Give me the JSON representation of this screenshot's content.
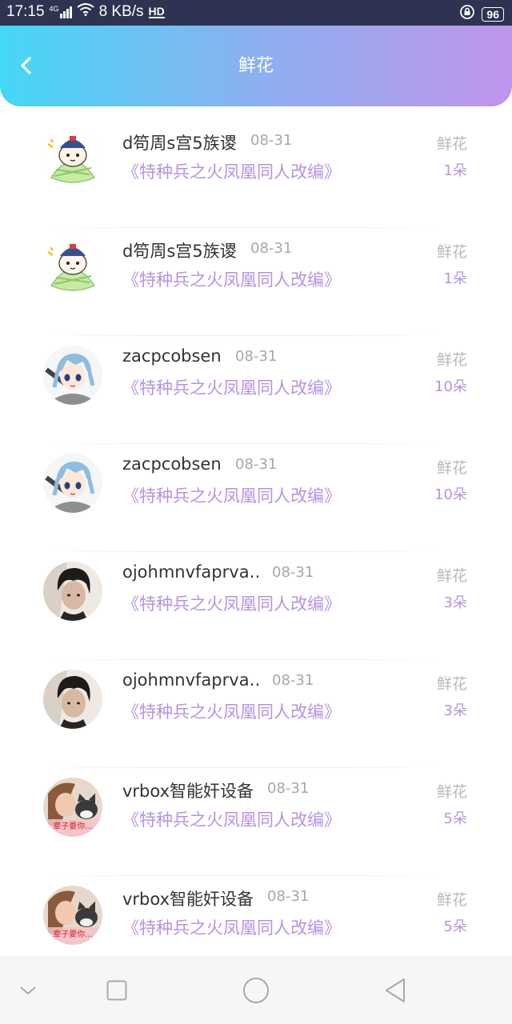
{
  "status_bar": {
    "time": "17:15",
    "network": "4G",
    "speed": "8 KB/s",
    "hd": "HD",
    "battery": "96"
  },
  "header": {
    "title": "鲜花"
  },
  "items": [
    {
      "name": "d笱周s宫5族谡",
      "date": "08-31",
      "book": "《特种兵之火凤凰同人改编》",
      "type": "鲜花",
      "count": "1朵",
      "avatar": "cartoon-rice-dumpling"
    },
    {
      "name": "d笱周s宫5族谡",
      "date": "08-31",
      "book": "《特种兵之火凤凰同人改编》",
      "type": "鲜花",
      "count": "1朵",
      "avatar": "cartoon-rice-dumpling"
    },
    {
      "name": "zacpcobsen",
      "date": "08-31",
      "book": "《特种兵之火凤凰同人改编》",
      "type": "鲜花",
      "count": "10朵",
      "avatar": "anime-blue-hair"
    },
    {
      "name": "zacpcobsen",
      "date": "08-31",
      "book": "《特种兵之火凤凰同人改编》",
      "type": "鲜花",
      "count": "10朵",
      "avatar": "anime-blue-hair"
    },
    {
      "name": "ojohmnvfaprva…",
      "date": "08-31",
      "book": "《特种兵之火凤凰同人改编》",
      "type": "鲜花",
      "count": "3朵",
      "avatar": "dark-hair-photo"
    },
    {
      "name": "ojohmnvfaprva…",
      "date": "08-31",
      "book": "《特种兵之火凤凰同人改编》",
      "type": "鲜花",
      "count": "3朵",
      "avatar": "dark-hair-photo"
    },
    {
      "name": "vrbox智能奸设备",
      "date": "08-31",
      "book": "《特种兵之火凤凰同人改编》",
      "type": "鲜花",
      "count": "5朵",
      "avatar": "woman-cat-photo",
      "avatar_text": "辈子要你..."
    },
    {
      "name": "vrbox智能奸设备",
      "date": "08-31",
      "book": "《特种兵之火凤凰同人改编》",
      "type": "鲜花",
      "count": "5朵",
      "avatar": "woman-cat-photo",
      "avatar_text": "辈子要你..."
    }
  ],
  "colors": {
    "header_gradient_start": "#45d7f7",
    "header_gradient_end": "#c094ec",
    "accent_purple": "#b693e0",
    "status_bar": "#2d3350"
  },
  "icons": {
    "back": "chevron-left-icon",
    "nav_hide": "chevron-down-icon",
    "nav_recents": "square-icon",
    "nav_home": "circle-icon",
    "nav_back": "triangle-back-icon"
  }
}
